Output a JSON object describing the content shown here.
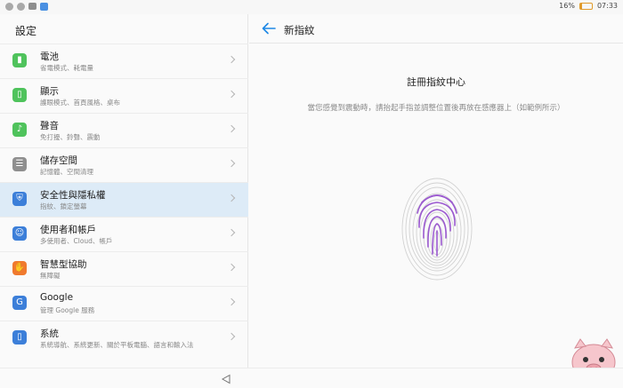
{
  "status_bar": {
    "battery_percent": "16%",
    "battery_level": 0.16,
    "time": "07:33"
  },
  "left_pane": {
    "title": "設定",
    "items": [
      {
        "title": "電池",
        "subtitle": "省電模式、耗電量",
        "icon": "battery-icon",
        "color": "#4fc35c"
      },
      {
        "title": "顯示",
        "subtitle": "護眼模式、首頁風格、桌布",
        "icon": "display-icon",
        "color": "#4fc35c"
      },
      {
        "title": "聲音",
        "subtitle": "免打擾、鈴聲、震動",
        "icon": "sound-icon",
        "color": "#4fc35c"
      },
      {
        "title": "儲存空間",
        "subtitle": "記憶體、空間清理",
        "icon": "storage-icon",
        "color": "#8f8f8f"
      },
      {
        "title": "安全性與隱私權",
        "subtitle": "指紋、鎖定螢幕",
        "icon": "shield-icon",
        "color": "#3c7fd9",
        "selected": true
      },
      {
        "title": "使用者和帳戶",
        "subtitle": "多使用者、Cloud、帳戶",
        "icon": "user-icon",
        "color": "#3c7fd9"
      },
      {
        "title": "智慧型協助",
        "subtitle": "無障礙",
        "icon": "hand-icon",
        "color": "#f07a2e"
      },
      {
        "title": "Google",
        "subtitle": "管理 Google 服務",
        "icon": "google-icon",
        "color": "#3c7fd9"
      },
      {
        "title": "系統",
        "subtitle": "系統導航、系統更新、關於平板電腦、語言和輸入法",
        "icon": "system-icon",
        "color": "#3c7fd9"
      }
    ]
  },
  "right_pane": {
    "title": "新指紋",
    "enroll_title": "註冊指紋中心",
    "enroll_hint": "當您感覺到震動時，請抬起手指並調整位置後再放在感應器上（如範例所示）"
  },
  "colors": {
    "accent": "#1e88e5",
    "fingerprint": "#9b59d0",
    "selected_bg": "#ddebf7"
  }
}
